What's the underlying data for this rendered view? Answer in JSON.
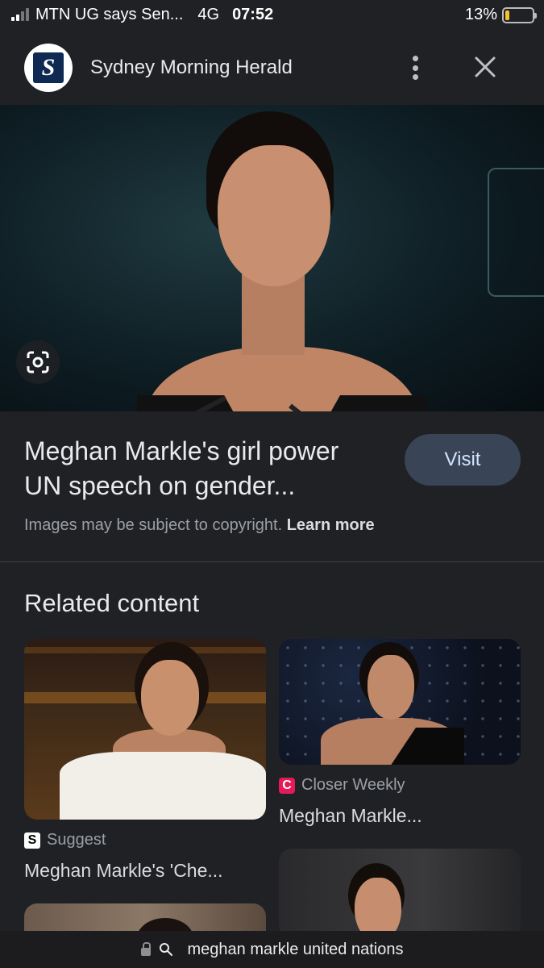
{
  "status_bar": {
    "carrier": "MTN UG says Sen...",
    "network": "4G",
    "time": "07:52",
    "battery": "13%",
    "battery_level": 0.13,
    "battery_color": "#f4c430"
  },
  "header": {
    "logo_letter": "S",
    "site_name": "Sydney Morning Herald",
    "more_icon": "more-vert-icon",
    "close_icon": "close-icon"
  },
  "hero": {
    "lens_icon": "google-lens-icon"
  },
  "result": {
    "title": "Meghan Markle's girl power UN speech on gender...",
    "visit_label": "Visit",
    "copyright_text": "Images may be subject to copyright.",
    "learn_more": "Learn more"
  },
  "related": {
    "heading": "Related content",
    "cards": [
      {
        "source_icon_letter": "S",
        "source": "Suggest",
        "title": "Meghan Markle's 'Che..."
      },
      {
        "source_icon_letter": "C",
        "source": "Closer Weekly",
        "title": "Meghan Markle..."
      }
    ]
  },
  "url_bar": {
    "query": "meghan markle united nations",
    "lock_icon": "lock-icon",
    "search_icon": "search-icon"
  },
  "colors": {
    "background": "#202124",
    "visit_button": "#394457",
    "closer_weekly_brand": "#e6195a"
  }
}
